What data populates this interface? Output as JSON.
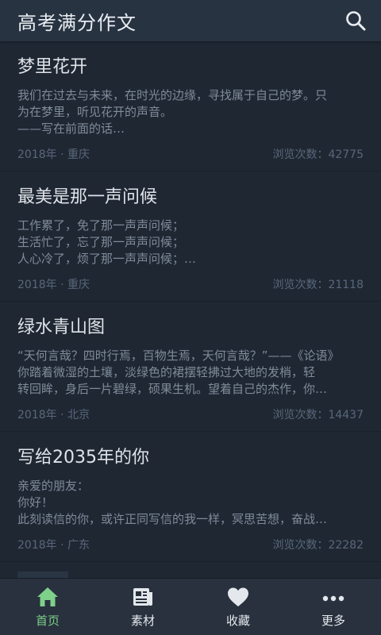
{
  "app_title": "高考满分作文",
  "articles": [
    {
      "title": "梦里花开",
      "excerpt": [
        "我们在过去与未来，在时光的边缘，寻找属于自己的梦。只",
        "为在梦里，听见花开的声音。",
        "——写在前面的话…"
      ],
      "meta_left": "2018年 · 重庆",
      "views": "浏览次数：42775"
    },
    {
      "title": "最美是那一声问候",
      "excerpt": [
        "工作累了，免了那一声声问候；",
        "生活忙了，忘了那一声声问候；",
        "人心冷了，烦了那一声声问候；…"
      ],
      "meta_left": "2018年 · 重庆",
      "views": "浏览次数：21118"
    },
    {
      "title": "绿水青山图",
      "excerpt": [
        "“天何言哉？四时行焉，百物生焉，天何言哉？”——《论语》",
        " 你踏着微湿的土壤，淡绿色的裙摆轻拂过大地的发梢，轻",
        "转回眸，身后一片碧绿，硕果生机。望着自己的杰作，你…"
      ],
      "meta_left": "2018年 · 北京",
      "views": "浏览次数：14437"
    },
    {
      "title": "写给2035年的你",
      "excerpt": [
        "亲爱的朋友：",
        " 你好！",
        " 此刻读信的你，或许正同写信的我一样，冥思苦想，奋战…"
      ],
      "meta_left": "2018年 · 广东",
      "views": "浏览次数：22282"
    }
  ],
  "tabs": [
    {
      "label": "首页",
      "icon": "home-icon",
      "active": true
    },
    {
      "label": "素材",
      "icon": "newspaper-icon",
      "active": false
    },
    {
      "label": "收藏",
      "icon": "heart-icon",
      "active": false
    },
    {
      "label": "更多",
      "icon": "more-dots-icon",
      "active": false
    }
  ],
  "colors": {
    "background": "#1f2733",
    "topbar": "#283342",
    "tabbar": "#28313d",
    "active_tab": "#7ed08b"
  }
}
